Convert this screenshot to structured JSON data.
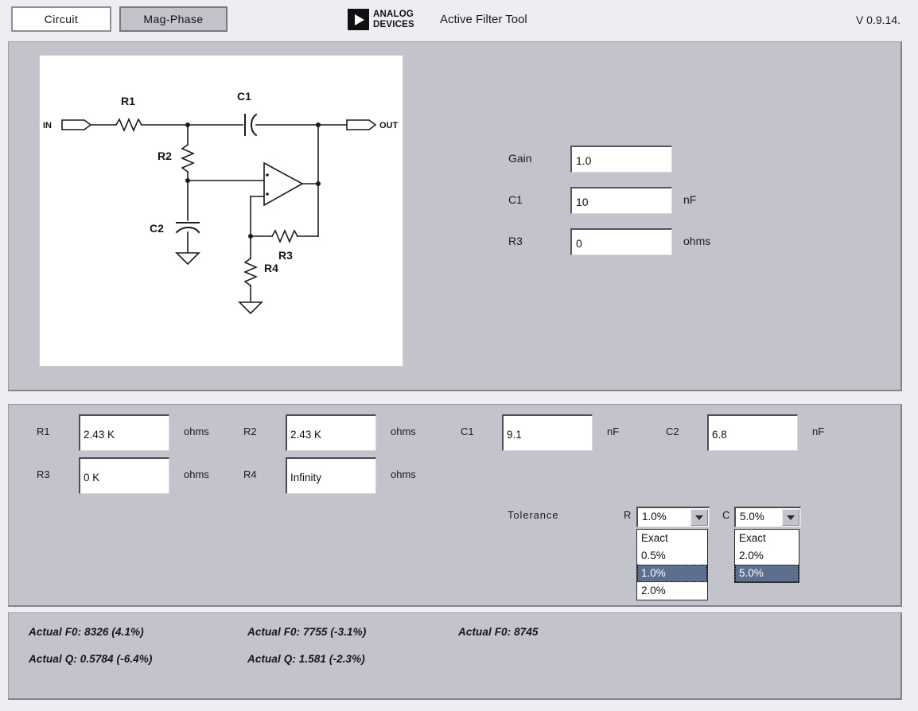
{
  "header": {
    "tabs": [
      {
        "label": "Circuit",
        "active": true
      },
      {
        "label": "Mag-Phase",
        "active": false
      }
    ],
    "logo": {
      "line1": "ANALOG",
      "line2": "DEVICES",
      "icon": "analog-devices-triangle-icon"
    },
    "title": "Active Filter Tool",
    "version": "V 0.9.14."
  },
  "schematic": {
    "in_label": "IN",
    "out_label": "OUT",
    "components": [
      "R1",
      "C1",
      "R2",
      "C2",
      "R3",
      "R4"
    ],
    "r1": "R1",
    "c1": "C1",
    "r2": "R2",
    "c2": "C2",
    "r3": "R3",
    "r4": "R4"
  },
  "params": {
    "gain": {
      "label": "Gain",
      "value": "1.0",
      "unit": ""
    },
    "c1": {
      "label": "C1",
      "value": "10",
      "unit": "nF"
    },
    "r3": {
      "label": "R3",
      "value": "0",
      "unit": "ohms"
    }
  },
  "values": {
    "r1": {
      "label": "R1",
      "value": "2.43 K",
      "unit": "ohms"
    },
    "r2": {
      "label": "R2",
      "value": "2.43 K",
      "unit": "ohms"
    },
    "c1": {
      "label": "C1",
      "value": "9.1",
      "unit": "nF"
    },
    "c2": {
      "label": "C2",
      "value": "6.8",
      "unit": "nF"
    },
    "r3": {
      "label": "R3",
      "value": "0 K",
      "unit": "ohms"
    },
    "r4": {
      "label": "R4",
      "value": "Infinity",
      "unit": "ohms"
    }
  },
  "tolerance": {
    "label": "Tolerance",
    "r": {
      "prefix": "R",
      "selected": "1.0%",
      "options": [
        "Exact",
        "0.5%",
        "1.0%",
        "2.0%"
      ]
    },
    "c": {
      "prefix": "C",
      "selected": "5.0%",
      "options": [
        "Exact",
        "2.0%",
        "5.0%"
      ]
    }
  },
  "status": {
    "col1_f0": "Actual F0: 8326 (4.1%)",
    "col1_q": "Actual Q: 0.5784 (-6.4%)",
    "col2_f0": "Actual F0: 7755 (-3.1%)",
    "col2_q": "Actual Q: 1.581 (-2.3%)",
    "col3_f0": "Actual F0: 8745"
  },
  "colors": {
    "panel": "#c3c3cb",
    "page": "#eceef2",
    "select_highlight": "#5c6f8e",
    "field": "#ffffff"
  }
}
